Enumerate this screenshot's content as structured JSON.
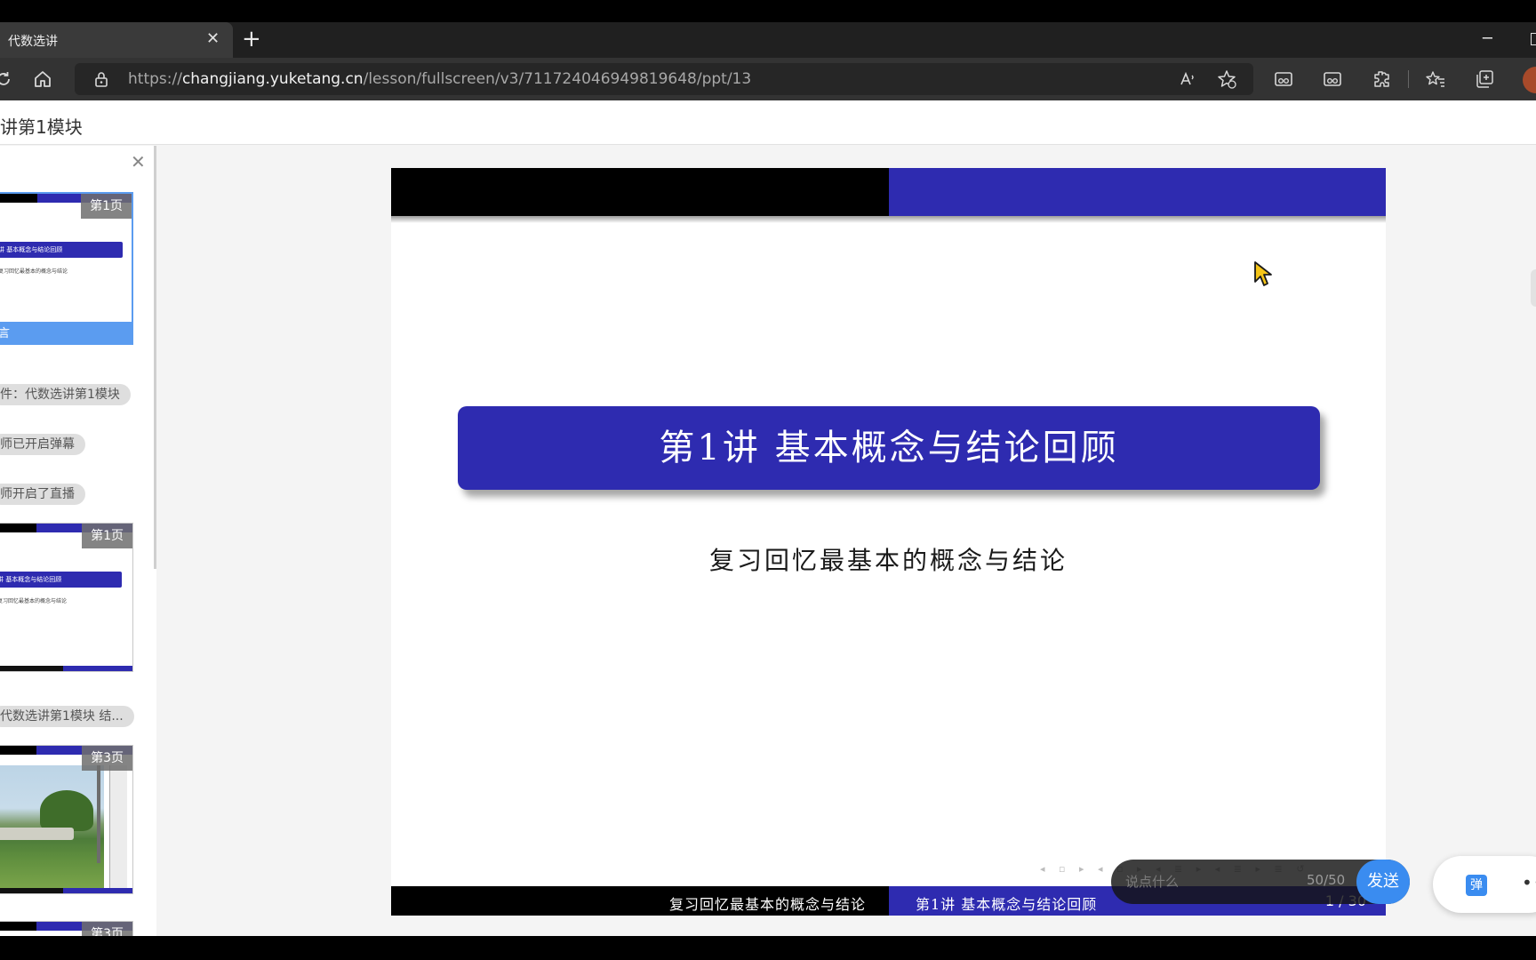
{
  "browser": {
    "tab_title": "代数选讲",
    "tab_close": "✕",
    "new_tab": "+",
    "url_prefix": "https://",
    "url_host": "changjiang.yuketang.cn",
    "url_path": "/lesson/fullscreen/v3/711724046949819648/ppt/13",
    "minimize": "─"
  },
  "page": {
    "title": "讲第1模块"
  },
  "sidebar": {
    "close": "✕",
    "items": [
      {
        "kind": "thumb",
        "page_label": "第1页",
        "title": "讲  基本概念与结论回顾",
        "subtitle": "复习回忆最基本的概念与结论",
        "footer": "言"
      },
      {
        "kind": "chip",
        "text": "件：代数选讲第1模块"
      },
      {
        "kind": "chip",
        "text": "师已开启弹幕"
      },
      {
        "kind": "chip",
        "text": "师开启了直播"
      },
      {
        "kind": "thumb",
        "page_label": "第1页",
        "title": "讲  基本概念与结论回顾",
        "subtitle": "复习回忆最基本的概念与结论"
      },
      {
        "kind": "chip",
        "text": "代数选讲第1模块 结..."
      },
      {
        "kind": "thumb",
        "page_label": "第3页"
      },
      {
        "kind": "thumb",
        "page_label": "第3页"
      }
    ]
  },
  "slide": {
    "title": "第1讲  基本概念与结论回顾",
    "subtitle": "复习回忆最基本的概念与结论",
    "footer_left": "复习回忆最基本的概念与结论",
    "footer_right": "第1讲  基本概念与结论回顾",
    "page_number": "1 / 30",
    "nav_symbols": "◂ ▫ ▸ ◂ ▫ ▸ ◂ ≣ ▸ ◂ ≣ ▸ ≣ ↺"
  },
  "danmaku": {
    "placeholder": "说点什么",
    "count": "50/50",
    "send_label": "发送",
    "toggle_label": "弹",
    "more": "•••"
  },
  "colors": {
    "slide_blue": "#2e2bb0",
    "accent_blue": "#3a8cf0",
    "thumb_active": "#5b9cf0"
  },
  "icons": [
    "refresh-icon",
    "home-icon",
    "lock-icon",
    "read-aloud-icon",
    "add-favorite-icon",
    "extension-icon",
    "favorites-icon",
    "collections-icon",
    "cursor-icon"
  ]
}
